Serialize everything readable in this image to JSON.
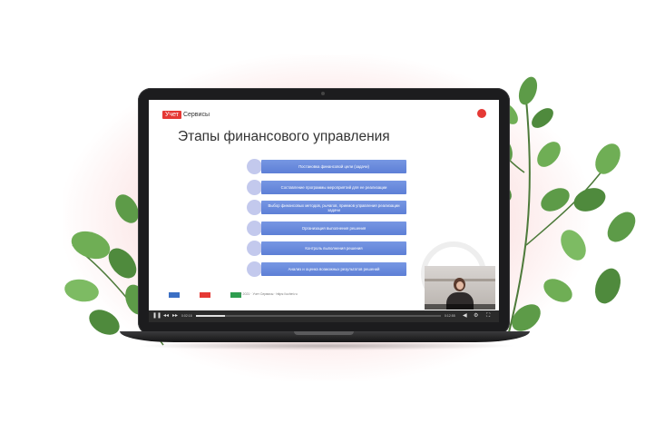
{
  "slide": {
    "logo_tag": "Учет",
    "logo_text": "Сервисы",
    "title": "Этапы финансового управления",
    "steps": [
      "Постановка финансовой цели (задачи)",
      "Составление программы мероприятий для ее реализации",
      "Выбор финансовых методов, рычагов, приемов управления реализации задачи",
      "Организация выполнения решения",
      "Контроль выполнения решения",
      "Анализ и оценка возможных результатов решений"
    ],
    "footer_text": "© 2021 · Учет Сервисы · https://uchet.ru"
  },
  "player": {
    "progress": 0.12,
    "current_time": "0:02:16",
    "total_time": "0:12:55",
    "icons": [
      "play-icon",
      "skip-back-icon",
      "skip-forward-icon",
      "volume-icon",
      "settings-icon",
      "fullscreen-icon"
    ]
  },
  "colors": {
    "brand_red": "#e53935",
    "step_blue": "#6a8ddd",
    "step_circle": "#c3c9ed",
    "glow_pink": "#f08c8c"
  }
}
